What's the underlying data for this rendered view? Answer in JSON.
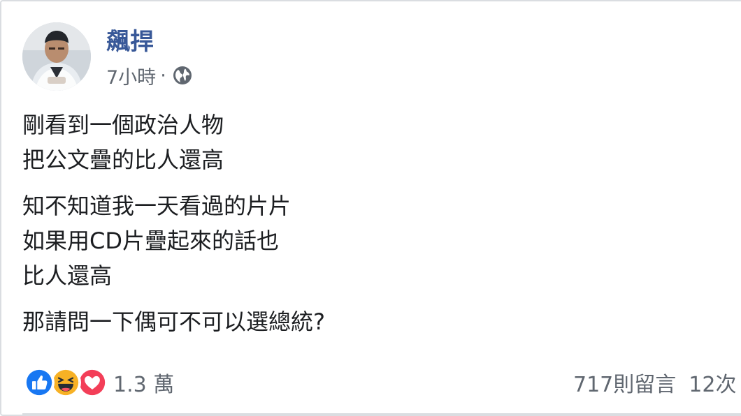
{
  "post": {
    "author": {
      "name": "飆捍",
      "avatar": "avatar-photo"
    },
    "meta": {
      "time": "7小時",
      "separator": "·",
      "privacy_icon": "globe-icon"
    },
    "paragraphs": [
      {
        "lines": [
          "剛看到一個政治人物",
          "把公文疊的比人還高"
        ]
      },
      {
        "lines": [
          "知不知道我一天看過的片片",
          "如果用CD片疊起來的話也",
          "比人還高"
        ]
      },
      {
        "lines": [
          "那請問一下偶可不可以選總統?"
        ]
      }
    ],
    "reactions": {
      "icons": [
        "like-icon",
        "haha-icon",
        "love-icon"
      ],
      "count": "1.3 萬"
    },
    "comments": "717則留言",
    "shares": "12次"
  },
  "colors": {
    "author_link": "#385898",
    "meta_text": "#606770",
    "body_text": "#1c1e21",
    "like": "#1877f2",
    "haha": "#f7b125",
    "love": "#f33e58",
    "border": "#dadde1"
  }
}
